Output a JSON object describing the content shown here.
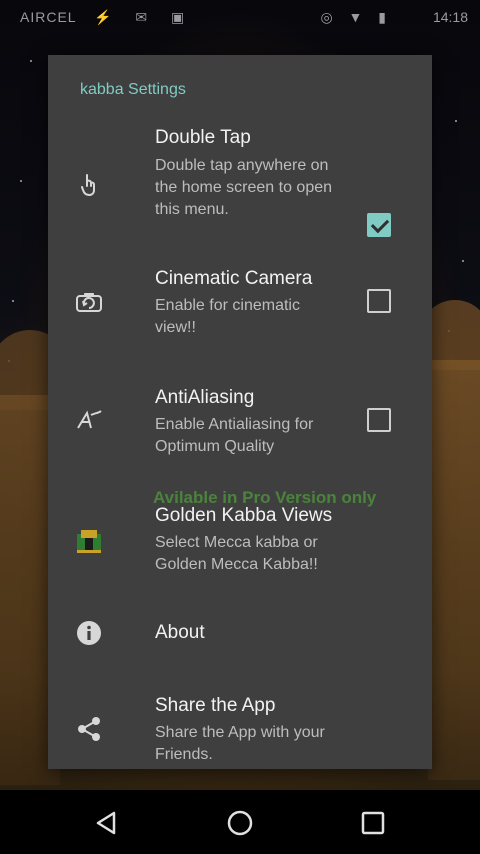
{
  "status_bar": {
    "carrier": "AIRCEL",
    "left_icons": "⚡ ✉ ▣",
    "right_icons": "◎ ▼ ▮",
    "time": "14:18"
  },
  "dialog": {
    "title": "kabba Settings",
    "pro_label": "Avilable in Pro Version only",
    "items": [
      {
        "icon": "tap-hand-icon",
        "title": "Double Tap",
        "summary": "Double tap anywhere on the home screen to open this menu.",
        "checked": true
      },
      {
        "icon": "camera-rotate-icon",
        "title": "Cinematic Camera",
        "summary": "Enable for cinematic view!!",
        "checked": false
      },
      {
        "icon": "antialias-icon",
        "title": "AntiAliasing",
        "summary": "Enable Antialiasing for Optimum Quality",
        "checked": false
      },
      {
        "icon": "kabba-icon",
        "title": "Golden Kabba Views",
        "summary": "Select Mecca kabba or Golden Mecca Kabba!!"
      },
      {
        "icon": "info-icon",
        "title": "About"
      },
      {
        "icon": "share-icon",
        "title": "Share the App",
        "summary": "Share the App with your Friends."
      }
    ]
  },
  "nav_bar": {
    "back": "back-icon",
    "home": "home-icon",
    "recents": "recents-icon"
  }
}
